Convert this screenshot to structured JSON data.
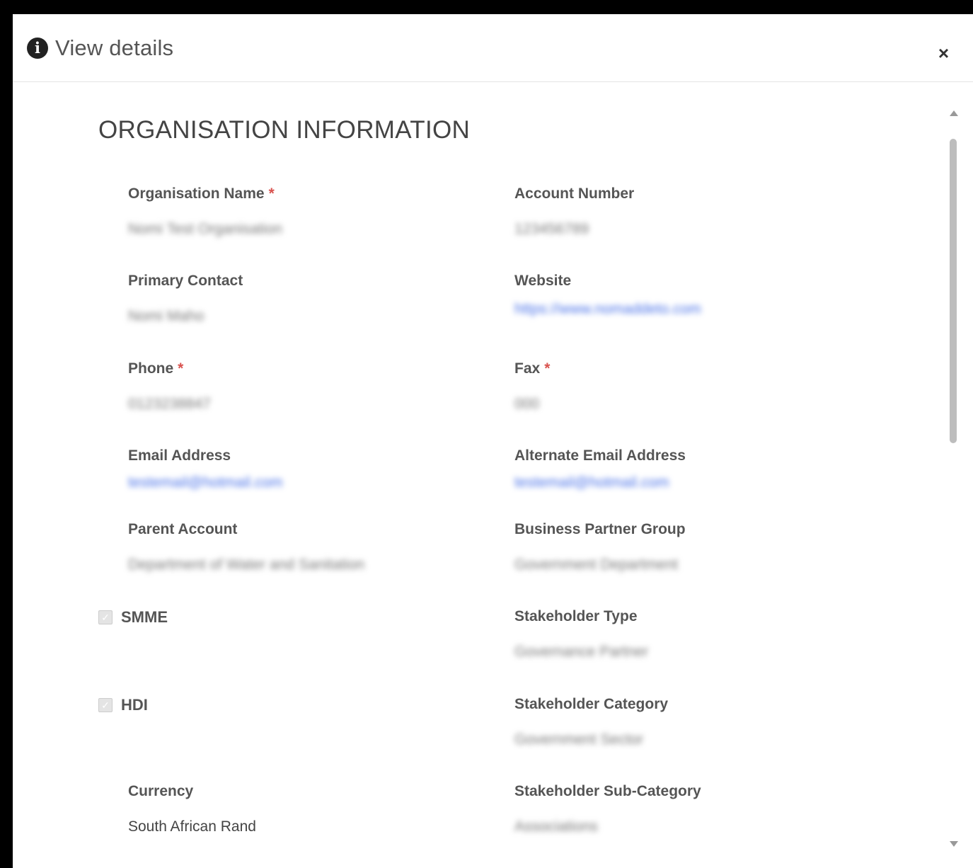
{
  "dialog": {
    "title": "View details",
    "close_label": "×",
    "info_icon_glyph": "i"
  },
  "section": {
    "title": "ORGANISATION INFORMATION"
  },
  "fields": {
    "org_name": {
      "label": "Organisation Name",
      "required": "*",
      "value": "Nomi Test Organisation"
    },
    "account_number": {
      "label": "Account Number",
      "value": "123456789"
    },
    "primary_contact": {
      "label": "Primary Contact",
      "value": "Nomi Maho"
    },
    "website": {
      "label": "Website",
      "value": "https://www.nomaddeto.com"
    },
    "phone": {
      "label": "Phone",
      "required": "*",
      "value": "0123238847"
    },
    "fax": {
      "label": "Fax",
      "required": "*",
      "value": "000"
    },
    "email": {
      "label": "Email Address",
      "value": "testemail@hotmail.com"
    },
    "alt_email": {
      "label": "Alternate Email Address",
      "value": "testemail@hotmail.com"
    },
    "parent_account": {
      "label": "Parent Account",
      "value": "Department of Water and Sanitation"
    },
    "bp_group": {
      "label": "Business Partner Group",
      "value": "Government Department"
    },
    "smme": {
      "label": "SMME",
      "checked": true
    },
    "stakeholder_type": {
      "label": "Stakeholder Type",
      "value": "Governance Partner"
    },
    "hdi": {
      "label": "HDI",
      "checked": true
    },
    "stakeholder_category": {
      "label": "Stakeholder Category",
      "value": "Government Sector"
    },
    "currency": {
      "label": "Currency",
      "value": "South African Rand"
    },
    "stakeholder_subcategory": {
      "label": "Stakeholder Sub-Category",
      "value": "Associations"
    }
  }
}
